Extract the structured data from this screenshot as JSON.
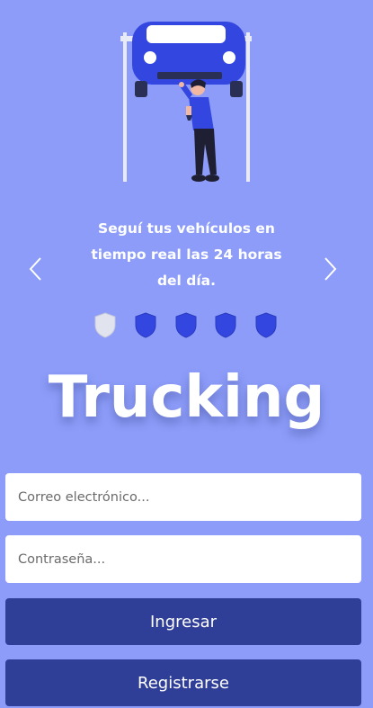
{
  "carousel": {
    "caption": "Seguí tus vehículos en tiempo real las 24 horas del día.",
    "prev_icon": "chevron-left-icon",
    "next_icon": "chevron-right-icon",
    "indicators": 5,
    "active_index": 0,
    "indicator_icon": "shield-icon"
  },
  "brand": {
    "title": "Trucking"
  },
  "form": {
    "email_placeholder": "Correo electrónico...",
    "password_placeholder": "Contraseña...",
    "login_label": "Ingresar",
    "register_label": "Registrarse"
  },
  "colors": {
    "background": "#8c9cf8",
    "button": "#2f3e96",
    "indicator_active": "#e1e4ee",
    "indicator_inactive": "#3347e0"
  }
}
